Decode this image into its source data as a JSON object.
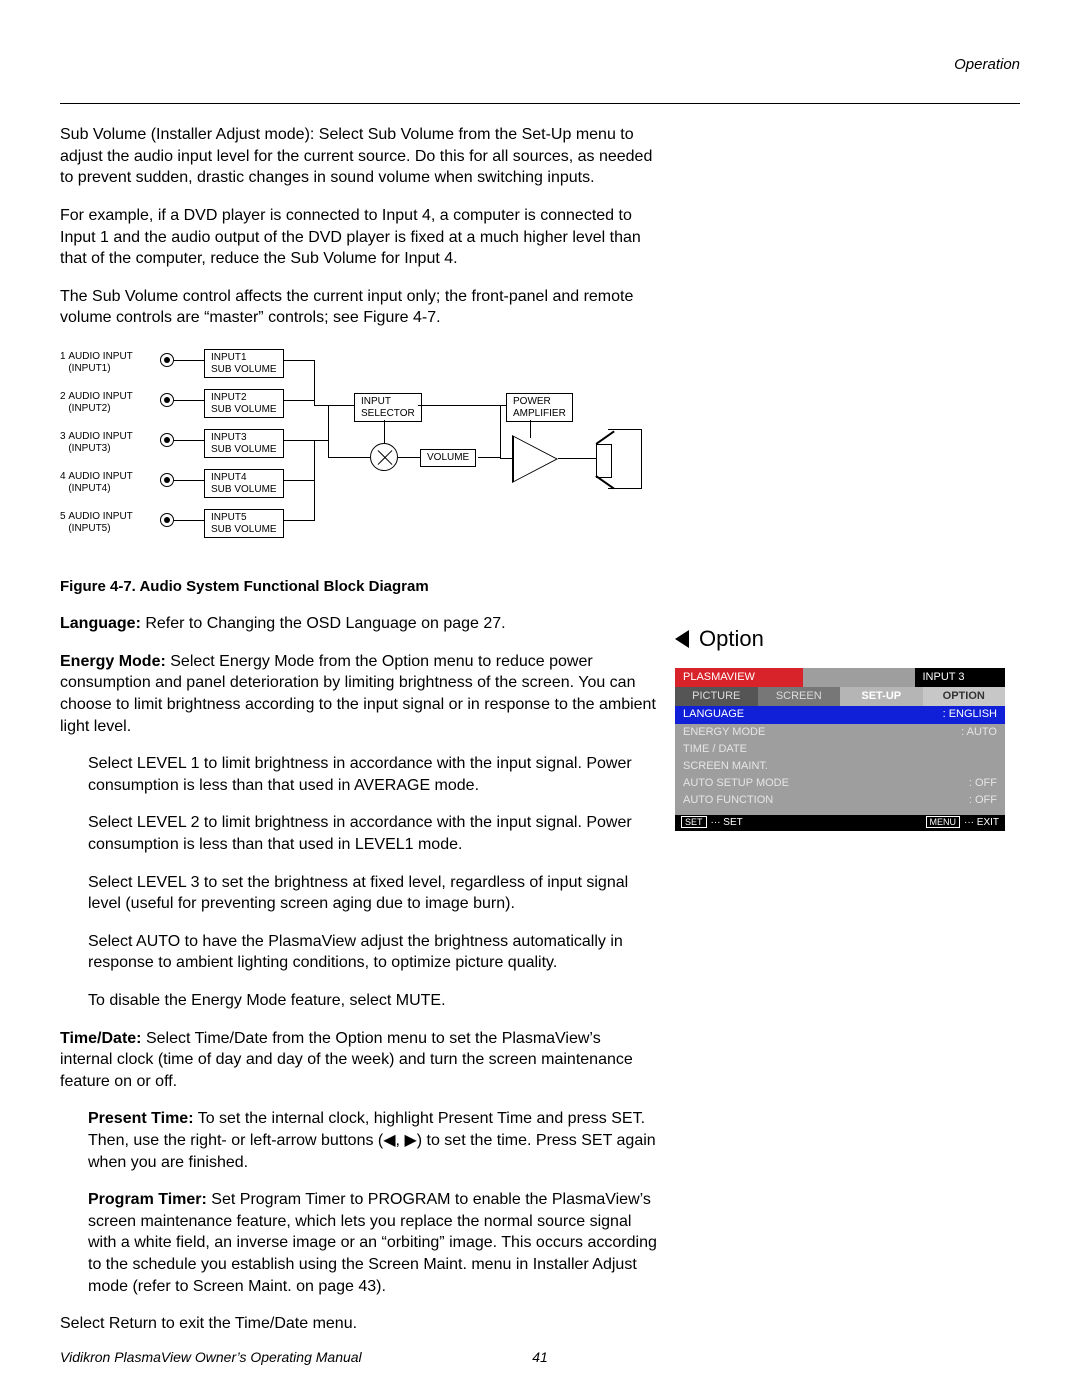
{
  "header": {
    "section": "Operation"
  },
  "paras": {
    "p1": "Sub Volume (Installer Adjust mode): Select Sub Volume from the Set-Up menu to adjust the audio input level for the current source. Do this for all sources, as needed to prevent sudden, drastic changes in sound volume when switching inputs.",
    "p2": "For example, if a DVD player is connected to Input 4, a computer is connected to Input 1 and the audio output of the DVD player is fixed at a much higher level than that of the computer, reduce the Sub Volume for Input 4.",
    "p3": "The Sub Volume control affects the current input only; the front-panel and remote volume controls are “master” controls; see Figure 4-7.",
    "fig_caption": "Figure 4-7. Audio System Functional Block Diagram",
    "p_lang_prefix": "Language:",
    "p_lang_rest": " Refer to Changing the OSD Language on page 27.",
    "p_energy_prefix": "Energy Mode:",
    "p_energy_rest": " Select Energy Mode from the Option menu to reduce power consumption and panel deterioration by limiting brightness of the screen. You can choose to limit brightness according to the input signal or in response to the ambient light level.",
    "level1": "Select LEVEL 1 to limit brightness in accordance with the input signal. Power consumption is less than that used in AVERAGE mode.",
    "level2": "Select LEVEL 2 to limit brightness in accordance with the input signal. Power consumption is less than that used in LEVEL1 mode.",
    "level3": "Select LEVEL 3 to set the brightness at fixed level, regardless of input signal level (useful for preventing screen aging due to image burn).",
    "auto": "Select AUTO to have the PlasmaView adjust the brightness automatically in response to ambient lighting conditions, to optimize picture quality.",
    "mute": "To disable the Energy Mode feature, select MUTE.",
    "p_time_prefix": "Time/Date:",
    "p_time_rest": " Select Time/Date from the Option menu to set the PlasmaView’s internal clock (time of day and day of the week) and turn the screen maintenance feature on or off.",
    "present_time_prefix": "Present Time:",
    "present_time_rest": " To set the internal clock, highlight Present Time and press SET. Then, use the right- or left-arrow buttons (◀, ▶) to set the time. Press SET again when you are finished.",
    "program_timer_prefix": "Program Timer:",
    "program_timer_rest": " Set Program Timer to PROGRAM to enable the PlasmaView’s screen maintenance feature, which lets you replace the normal source signal with a white field, an inverse image or an “orbiting” image. This occurs according to the schedule you establish using the Screen Maint. menu in Installer Adjust mode (refer to Screen Maint. on page 43).",
    "p_return": "Select Return to exit the Time/Date menu."
  },
  "diagram": {
    "inputs": [
      {
        "n": "1",
        "label": "AUDIO INPUT",
        "sub": "(INPUT1)"
      },
      {
        "n": "2",
        "label": "AUDIO INPUT",
        "sub": "(INPUT2)"
      },
      {
        "n": "3",
        "label": "AUDIO INPUT",
        "sub": "(INPUT3)"
      },
      {
        "n": "4",
        "label": "AUDIO INPUT",
        "sub": "(INPUT4)"
      },
      {
        "n": "5",
        "label": "AUDIO INPUT",
        "sub": "(INPUT5)"
      }
    ],
    "subboxes": [
      "INPUT1\nSUB VOLUME",
      "INPUT2\nSUB VOLUME",
      "INPUT3\nSUB VOLUME",
      "INPUT4\nSUB VOLUME",
      "INPUT5\nSUB VOLUME"
    ],
    "selector": "INPUT\nSELECTOR",
    "volume": "VOLUME",
    "amplifier": "POWER\nAMPLIFIER"
  },
  "option_heading": "Option",
  "osd": {
    "brand": "PLASMAVIEW",
    "input": "INPUT 3",
    "tabs": [
      "PICTURE",
      "SCREEN",
      "SET-UP",
      "OPTION"
    ],
    "items": [
      {
        "label": "LANGUAGE",
        "value": ": ENGLISH",
        "selected": true
      },
      {
        "label": "ENERGY MODE",
        "value": ": AUTO"
      },
      {
        "label": "TIME / DATE",
        "value": ""
      },
      {
        "label": "SCREEN MAINT.",
        "value": ""
      },
      {
        "label": "AUTO SETUP MODE",
        "value": ": OFF"
      },
      {
        "label": "AUTO FUNCTION",
        "value": ": OFF"
      }
    ],
    "foot_left_key": "SET",
    "foot_left_text": "··· SET",
    "foot_right_key": "MENU",
    "foot_right_text": "··· EXIT"
  },
  "footer": {
    "title": "Vidikron PlasmaView Owner’s Operating Manual",
    "page": "41"
  },
  "chart_data": {
    "type": "diagram",
    "description": "Audio block diagram: five audio inputs each feed a per-input Sub Volume stage, then an Input Selector, a summing/mixer node, a master Volume control, a Power Amplifier, and finally a loudspeaker.",
    "nodes": [
      {
        "id": "in1",
        "label": "AUDIO INPUT (INPUT1)"
      },
      {
        "id": "in2",
        "label": "AUDIO INPUT (INPUT2)"
      },
      {
        "id": "in3",
        "label": "AUDIO INPUT (INPUT3)"
      },
      {
        "id": "in4",
        "label": "AUDIO INPUT (INPUT4)"
      },
      {
        "id": "in5",
        "label": "AUDIO INPUT (INPUT5)"
      },
      {
        "id": "sv1",
        "label": "INPUT1 SUB VOLUME"
      },
      {
        "id": "sv2",
        "label": "INPUT2 SUB VOLUME"
      },
      {
        "id": "sv3",
        "label": "INPUT3 SUB VOLUME"
      },
      {
        "id": "sv4",
        "label": "INPUT4 SUB VOLUME"
      },
      {
        "id": "sv5",
        "label": "INPUT5 SUB VOLUME"
      },
      {
        "id": "sel",
        "label": "INPUT SELECTOR"
      },
      {
        "id": "mix",
        "label": "mixer"
      },
      {
        "id": "vol",
        "label": "VOLUME"
      },
      {
        "id": "amp",
        "label": "POWER AMPLIFIER"
      },
      {
        "id": "spk",
        "label": "Loudspeaker"
      }
    ],
    "edges": [
      [
        "in1",
        "sv1"
      ],
      [
        "in2",
        "sv2"
      ],
      [
        "in3",
        "sv3"
      ],
      [
        "in4",
        "sv4"
      ],
      [
        "in5",
        "sv5"
      ],
      [
        "sv1",
        "sel"
      ],
      [
        "sv2",
        "sel"
      ],
      [
        "sv3",
        "sel"
      ],
      [
        "sv4",
        "sel"
      ],
      [
        "sv5",
        "sel"
      ],
      [
        "sel",
        "mix"
      ],
      [
        "mix",
        "vol"
      ],
      [
        "vol",
        "amp"
      ],
      [
        "amp",
        "spk"
      ]
    ]
  }
}
